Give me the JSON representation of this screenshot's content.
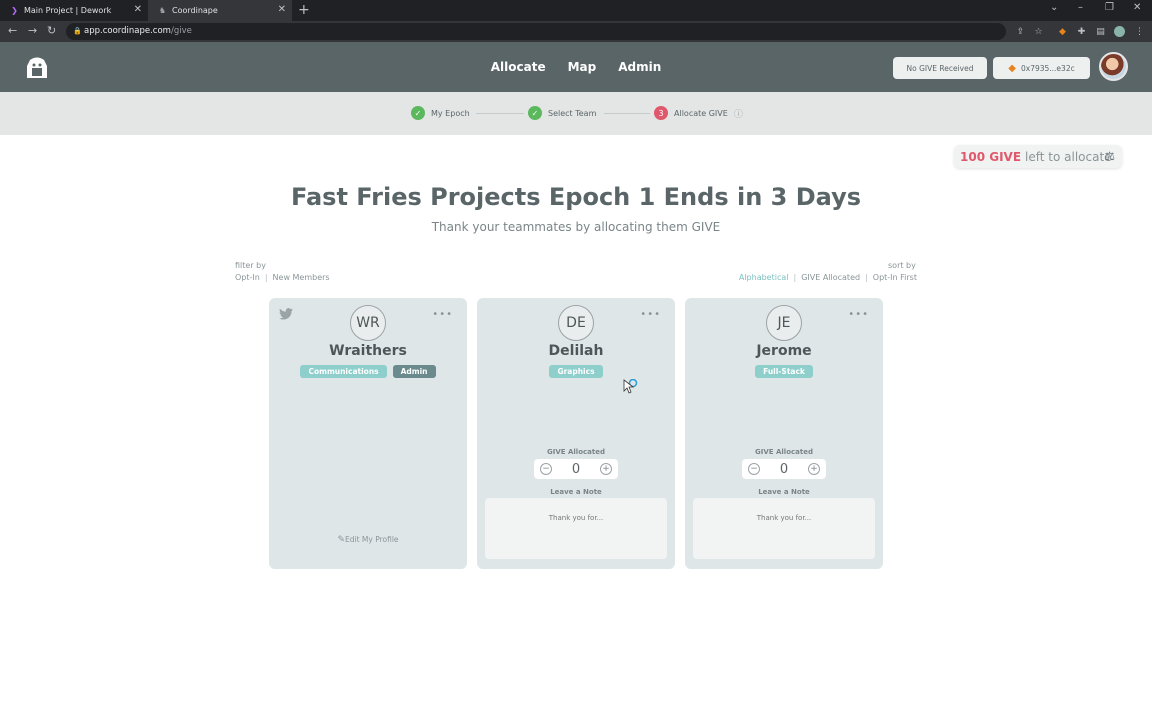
{
  "browser": {
    "tabs": [
      {
        "title": "Main Project | Dework",
        "icon": "dework-icon"
      },
      {
        "title": "Coordinape",
        "icon": "coordinape-icon"
      }
    ],
    "url_host": "app.coordinape.com",
    "url_path": "/give"
  },
  "header": {
    "nav": [
      "Allocate",
      "Map",
      "Admin"
    ],
    "give_received": "No GIVE Received",
    "wallet": "0x7935...e32c"
  },
  "stepper": {
    "steps": [
      {
        "label": "My Epoch",
        "state": "done"
      },
      {
        "label": "Select Team",
        "state": "done"
      },
      {
        "label": "Allocate GIVE",
        "state": "current",
        "number": "3"
      }
    ]
  },
  "remaining": {
    "amount": "100 GIVE",
    "text": "left to allocate"
  },
  "page": {
    "title": "Fast Fries Projects Epoch 1 Ends in 3 Days",
    "subtitle": "Thank your teammates by allocating them GIVE"
  },
  "filter": {
    "label": "filter by",
    "options": [
      "Opt-In",
      "New Members"
    ]
  },
  "sort": {
    "label": "sort by",
    "options": [
      "Alphabetical",
      "GIVE Allocated",
      "Opt-In First"
    ],
    "selected": "Alphabetical"
  },
  "cards": [
    {
      "initials": "WR",
      "name": "Wraithers",
      "tags": [
        "Communications",
        "Admin"
      ],
      "edit_label": "Edit My Profile"
    },
    {
      "initials": "DE",
      "name": "Delilah",
      "tags": [
        "Graphics"
      ],
      "give_label": "GIVE Allocated",
      "give_value": "0",
      "note_label": "Leave a Note",
      "note_placeholder": "Thank you for..."
    },
    {
      "initials": "JE",
      "name": "Jerome",
      "tags": [
        "Full-Stack"
      ],
      "give_label": "GIVE Allocated",
      "give_value": "0",
      "note_label": "Leave a Note",
      "note_placeholder": "Thank you for..."
    }
  ],
  "colors": {
    "header_bg": "#5a6568",
    "accent_red": "#e0586b",
    "accent_teal": "#8ecfcc",
    "done_green": "#5cb85c"
  }
}
